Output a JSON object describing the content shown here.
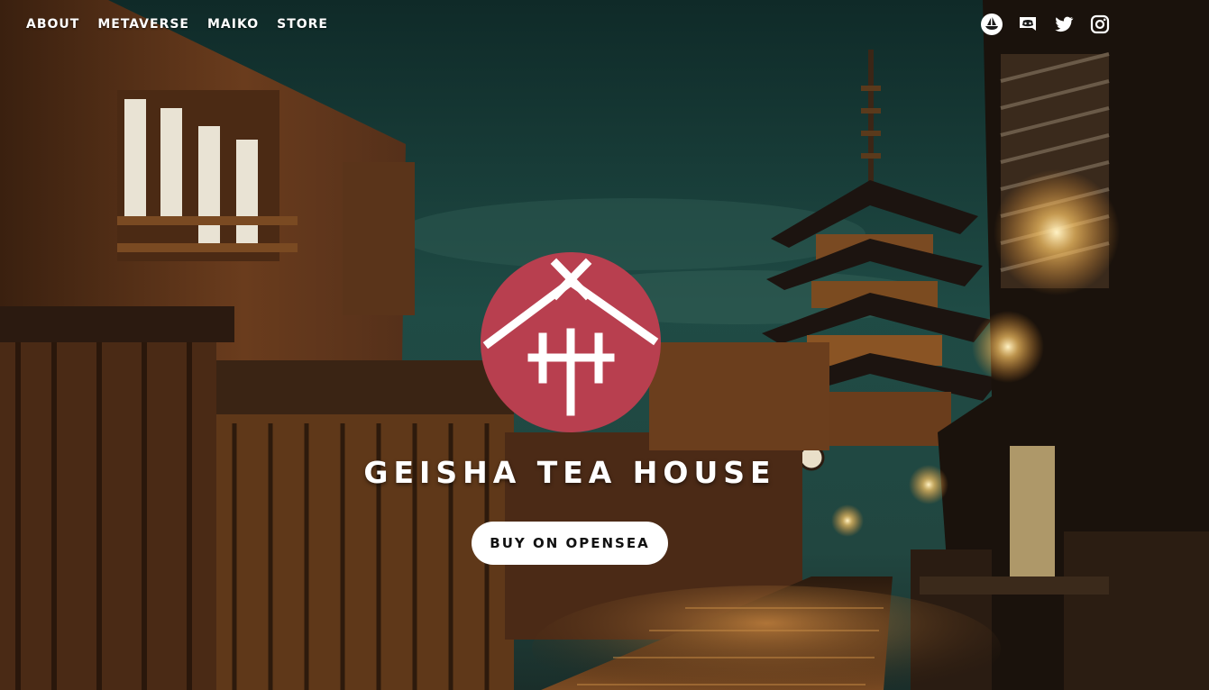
{
  "nav": {
    "items": [
      {
        "label": "ABOUT"
      },
      {
        "label": "METAVERSE"
      },
      {
        "label": "MAIKO"
      },
      {
        "label": "STORE"
      }
    ]
  },
  "socials": [
    {
      "icon": "opensea-icon"
    },
    {
      "icon": "discord-icon"
    },
    {
      "icon": "twitter-icon"
    },
    {
      "icon": "instagram-icon"
    }
  ],
  "hero": {
    "title": "GEISHA TEA HOUSE",
    "cta_label": "BUY ON OPENSEA"
  },
  "colors": {
    "logo_red": "#b83f4f",
    "sky": "#1d3f3a",
    "lantern": "#ffd58a",
    "wood": "#6b3a1c"
  }
}
